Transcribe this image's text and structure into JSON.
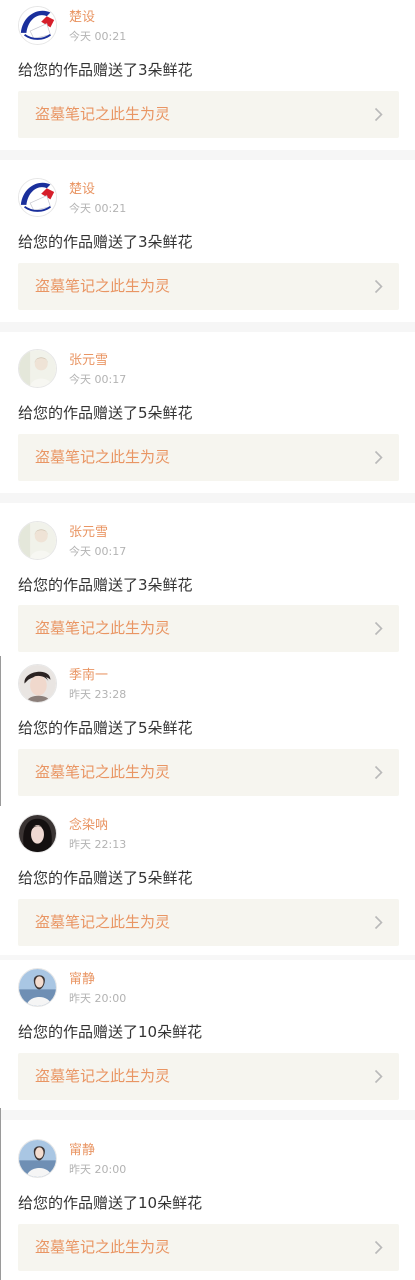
{
  "colors": {
    "accent": "#e99563",
    "time": "#b3b3b3",
    "text": "#333333",
    "card_bg": "#f6f5ef",
    "separator": "#f6f6f6"
  },
  "notifications": [
    {
      "user": "楚设",
      "time": "今天 00:21",
      "message": "给您的作品赠送了3朵鲜花",
      "work_title": "盗墓笔记之此生为灵",
      "avatar": "flag-avatar",
      "chevron_icon": "chevron-right-icon"
    },
    {
      "user": "楚设",
      "time": "今天 00:21",
      "message": "给您的作品赠送了3朵鲜花",
      "work_title": "盗墓笔记之此生为灵",
      "avatar": "flag-avatar",
      "chevron_icon": "chevron-right-icon"
    },
    {
      "user": "张元雪",
      "time": "今天 00:17",
      "message": "给您的作品赠送了5朵鲜花",
      "work_title": "盗墓笔记之此生为灵",
      "avatar": "pale-portrait-avatar",
      "chevron_icon": "chevron-right-icon"
    },
    {
      "user": "张元雪",
      "time": "今天 00:17",
      "message": "给您的作品赠送了3朵鲜花",
      "work_title": "盗墓笔记之此生为灵",
      "avatar": "pale-portrait-avatar",
      "chevron_icon": "chevron-right-icon"
    },
    {
      "user": "季南一",
      "time": "昨天 23:28",
      "message": "给您的作品赠送了5朵鲜花",
      "work_title": "盗墓笔记之此生为灵",
      "avatar": "boy-portrait-avatar",
      "chevron_icon": "chevron-right-icon"
    },
    {
      "user": "念染呐",
      "time": "昨天 22:13",
      "message": "给您的作品赠送了5朵鲜花",
      "work_title": "盗墓笔记之此生为灵",
      "avatar": "dark-hair-portrait-avatar",
      "chevron_icon": "chevron-right-icon"
    },
    {
      "user": "甯静",
      "time": "昨天 20:00",
      "message": "给您的作品赠送了10朵鲜花",
      "work_title": "盗墓笔记之此生为灵",
      "avatar": "sky-portrait-avatar",
      "chevron_icon": "chevron-right-icon"
    },
    {
      "user": "甯静",
      "time": "昨天 20:00",
      "message": "给您的作品赠送了10朵鲜花",
      "work_title": "盗墓笔记之此生为灵",
      "avatar": "sky-portrait-avatar",
      "chevron_icon": "chevron-right-icon"
    }
  ]
}
